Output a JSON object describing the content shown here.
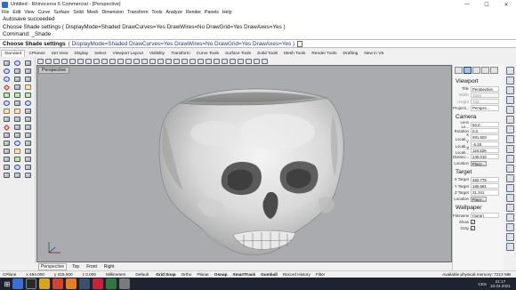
{
  "window": {
    "title": "Untitled - Rhinoceros 6 Commercial - [Perspective]",
    "controls": [
      "—",
      "☐",
      "✕"
    ]
  },
  "menu": [
    "File",
    "Edit",
    "View",
    "Curve",
    "Surface",
    "Solid",
    "Mesh",
    "Dimension",
    "Transform",
    "Tools",
    "Analyze",
    "Render",
    "Panels",
    "Help"
  ],
  "command_history": [
    "Autosave succeeded",
    "Choose Shade settings ( DisplayMode=Shaded  DrawCurves=Yes  DrawWires=No  DrawGrid=Yes  DrawAxes=Yes )",
    "Command: _Shade"
  ],
  "command_line": {
    "prompt": "Choose Shade settings",
    "options": "( DisplayMode=Shaded  DrawCurves=Yes  DrawWires=No  DrawGrid=Yes  DrawAxes=Yes )"
  },
  "toolbar_tabs": [
    "Standard",
    "CPlanes",
    "Set View",
    "Display",
    "Select",
    "Viewport Layout",
    "Visibility",
    "Transform",
    "Curve Tools",
    "Surface Tools",
    "Solid Tools",
    "Mesh Tools",
    "Render Tools",
    "Drafting",
    "New in V6"
  ],
  "active_toolbar_tab": "Standard",
  "viewport": {
    "label": "Perspective"
  },
  "viewport_tabs": [
    "Perspective",
    "Top",
    "Front",
    "Right"
  ],
  "active_viewport_tab": "Perspective",
  "properties": {
    "viewport_heading": "Viewport",
    "viewport_rows": [
      {
        "k": "Title",
        "v": "Perspective",
        "disabled": false
      },
      {
        "k": "Width",
        "v": "1544",
        "disabled": true
      },
      {
        "k": "Height",
        "v": "734",
        "disabled": true
      },
      {
        "k": "Projecti...",
        "v": "Perspec...",
        "disabled": false
      }
    ],
    "camera_heading": "Camera",
    "camera_rows": [
      {
        "k": "Lens Le...",
        "v": "50.0"
      },
      {
        "k": "Rotation",
        "v": "0.0"
      },
      {
        "k": "X Locati...",
        "v": "591.503"
      },
      {
        "k": "Y Locati...",
        "v": "-5.28"
      },
      {
        "k": "Z Locati...",
        "v": "118.528"
      },
      {
        "k": "Distanc...",
        "v": "240.016"
      }
    ],
    "camera_location": {
      "k": "Location",
      "btn": "Place..."
    },
    "target_heading": "Target",
    "target_rows": [
      {
        "k": "X Target",
        "v": "483.775"
      },
      {
        "k": "Y Target",
        "v": "190.681"
      },
      {
        "k": "Z Target",
        "v": "31.341"
      }
    ],
    "target_location": {
      "k": "Location",
      "btn": "Place..."
    },
    "wallpaper_heading": "Wallpaper",
    "wallpaper_rows": [
      {
        "k": "Filename",
        "v": "(none)"
      }
    ],
    "show": {
      "k": "Show",
      "checked": "✓"
    },
    "gray": {
      "k": "Gray",
      "checked": "✓"
    }
  },
  "status": {
    "cplane": "CPlane",
    "x": "x 494.000",
    "y": "y 419.000",
    "z": "z 0.000",
    "units": "Millimeters",
    "layer": "Default",
    "toggles": [
      "Grid Snap",
      "Ortho",
      "Planar",
      "Osnap",
      "SmartTrack",
      "Gumball",
      "Record History",
      "Filter"
    ],
    "memory": "Available physical memory: 7213 MB"
  },
  "taskbar": {
    "language": "CES",
    "time": "21:17",
    "date": "10.04.2021"
  }
}
